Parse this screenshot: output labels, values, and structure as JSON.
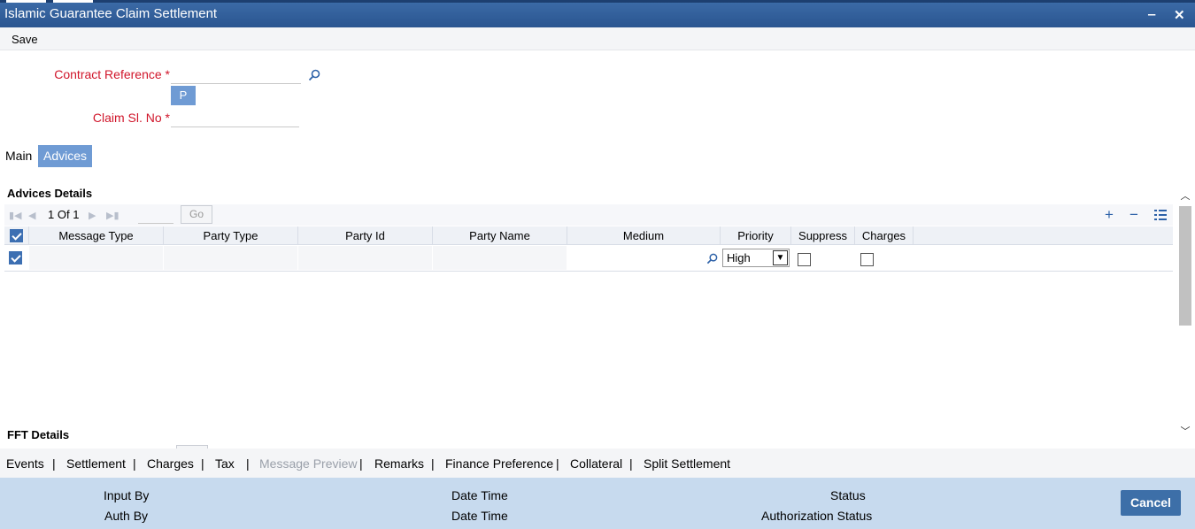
{
  "window": {
    "title": "Islamic Guarantee Claim Settlement",
    "minimize_glyph": "‒",
    "close_glyph": "✕"
  },
  "menu": {
    "save_label": "Save"
  },
  "form": {
    "contract_reference": {
      "label": "Contract Reference",
      "required_mark": "*",
      "value": ""
    },
    "p_button_label": "P",
    "claim_sl_no": {
      "label": "Claim Sl. No",
      "required_mark": "*",
      "value": ""
    }
  },
  "tabs": [
    {
      "label": "Main",
      "active": false
    },
    {
      "label": "Advices",
      "active": true
    }
  ],
  "advices": {
    "title": "Advices Details",
    "pager": {
      "current": "1",
      "of_label": "Of",
      "total": "1",
      "go_label": "Go"
    },
    "columns": [
      "Message Type",
      "Party Type",
      "Party Id",
      "Party Name",
      "Medium",
      "Priority",
      "Suppress",
      "Charges"
    ],
    "rows": [
      {
        "selected": true,
        "message_type": "",
        "party_type": "",
        "party_id": "",
        "party_name": "",
        "medium": "",
        "priority": "High",
        "suppress": false,
        "charges": false
      }
    ]
  },
  "fft": {
    "title": "FFT Details"
  },
  "bottom_links": [
    {
      "label": "Events",
      "enabled": true
    },
    {
      "label": "Settlement",
      "enabled": true
    },
    {
      "label": "Charges",
      "enabled": true
    },
    {
      "label": "Tax",
      "enabled": true
    },
    {
      "label": "Message Preview",
      "enabled": false
    },
    {
      "label": "Remarks",
      "enabled": true
    },
    {
      "label": "Finance Preference",
      "enabled": true
    },
    {
      "label": "Collateral",
      "enabled": true
    },
    {
      "label": "Split Settlement",
      "enabled": true
    }
  ],
  "link_separator": "|",
  "footer": {
    "input_by": "Input By",
    "auth_by": "Auth By",
    "date_time_1": "Date Time",
    "date_time_2": "Date Time",
    "status": "Status",
    "authorization_status": "Authorization Status",
    "cancel_label": "Cancel"
  },
  "colors": {
    "title_bar": "#2f5d99",
    "accent_button": "#6f9bd4",
    "required_label": "#d0152a",
    "footer_bg": "#c7daee",
    "cancel_button": "#3d6fa8"
  }
}
